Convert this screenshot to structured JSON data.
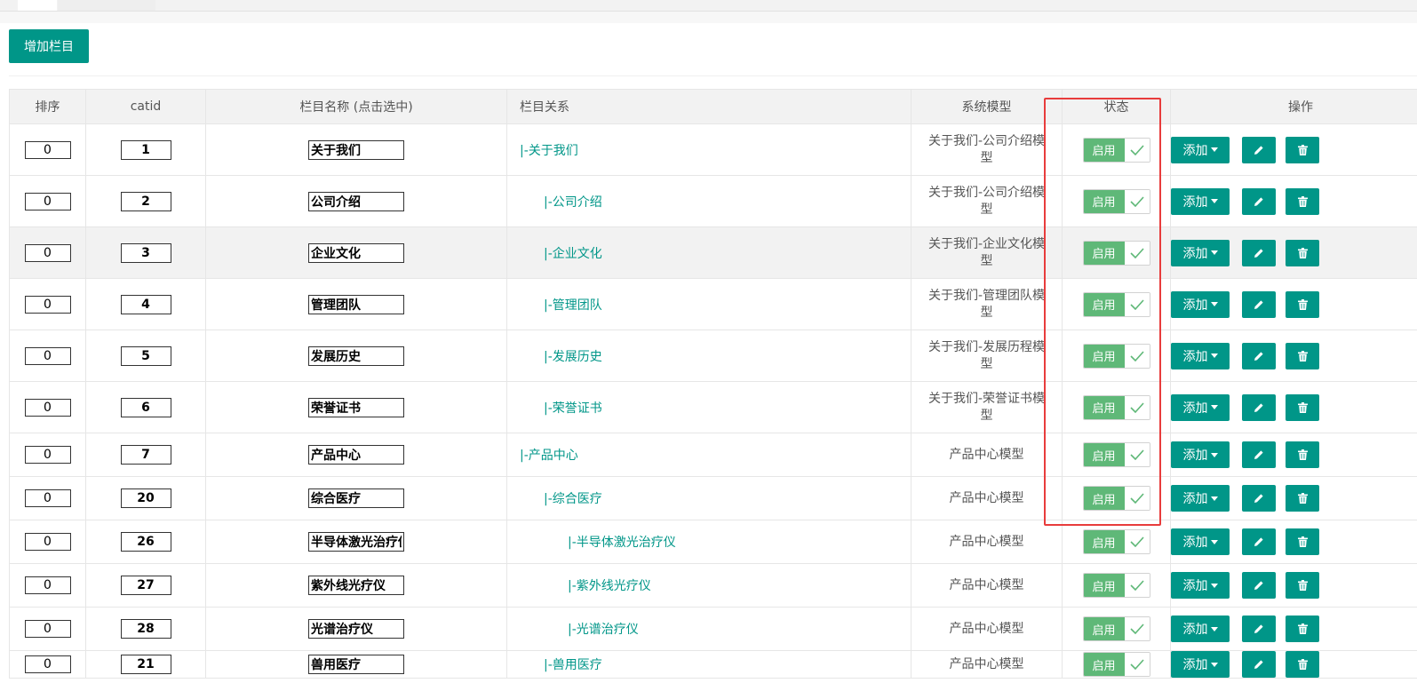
{
  "toolbar": {
    "add_category_label": "增加栏目"
  },
  "columns": {
    "sort": "排序",
    "catid": "catid",
    "name": "栏目名称 (点击选中)",
    "relation": "栏目关系",
    "model": "系统模型",
    "status": "状态",
    "actions": "操作"
  },
  "status_label": "启用",
  "add_label": "添加",
  "rows": [
    {
      "sort": "0",
      "catid": "1",
      "name": "关于我们",
      "relation": "|-关于我们",
      "level": 0,
      "model_l1": "关于我们-公司介绍模",
      "model_l2": "型"
    },
    {
      "sort": "0",
      "catid": "2",
      "name": "公司介绍",
      "relation": "|-公司介绍",
      "level": 1,
      "model_l1": "关于我们-公司介绍模",
      "model_l2": "型"
    },
    {
      "sort": "0",
      "catid": "3",
      "name": "企业文化",
      "relation": "|-企业文化",
      "level": 1,
      "model_l1": "关于我们-企业文化模",
      "model_l2": "型"
    },
    {
      "sort": "0",
      "catid": "4",
      "name": "管理团队",
      "relation": "|-管理团队",
      "level": 1,
      "model_l1": "关于我们-管理团队模",
      "model_l2": "型"
    },
    {
      "sort": "0",
      "catid": "5",
      "name": "发展历史",
      "relation": "|-发展历史",
      "level": 1,
      "model_l1": "关于我们-发展历程模",
      "model_l2": "型"
    },
    {
      "sort": "0",
      "catid": "6",
      "name": "荣誉证书",
      "relation": "|-荣誉证书",
      "level": 1,
      "model_l1": "关于我们-荣誉证书模",
      "model_l2": "型"
    },
    {
      "sort": "0",
      "catid": "7",
      "name": "产品中心",
      "relation": "|-产品中心",
      "level": 0,
      "model_l1": "产品中心模型",
      "model_l2": ""
    },
    {
      "sort": "0",
      "catid": "20",
      "name": "综合医疗",
      "relation": "|-综合医疗",
      "level": 1,
      "model_l1": "产品中心模型",
      "model_l2": ""
    },
    {
      "sort": "0",
      "catid": "26",
      "name": "半导体激光治疗仪",
      "relation": "|-半导体激光治疗仪",
      "level": 2,
      "model_l1": "产品中心模型",
      "model_l2": ""
    },
    {
      "sort": "0",
      "catid": "27",
      "name": "紫外线光疗仪",
      "relation": "|-紫外线光疗仪",
      "level": 2,
      "model_l1": "产品中心模型",
      "model_l2": ""
    },
    {
      "sort": "0",
      "catid": "28",
      "name": "光谱治疗仪",
      "relation": "|-光谱治疗仪",
      "level": 2,
      "model_l1": "产品中心模型",
      "model_l2": ""
    },
    {
      "sort": "0",
      "catid": "21",
      "name": "兽用医疗",
      "relation": "|-兽用医疗",
      "level": 1,
      "model_l1": "产品中心模型",
      "model_l2": ""
    }
  ],
  "colors": {
    "primary": "#009688",
    "switch_on": "#5fb878",
    "highlight_box": "#e83c3c",
    "header_bg": "#f2f2f2"
  }
}
